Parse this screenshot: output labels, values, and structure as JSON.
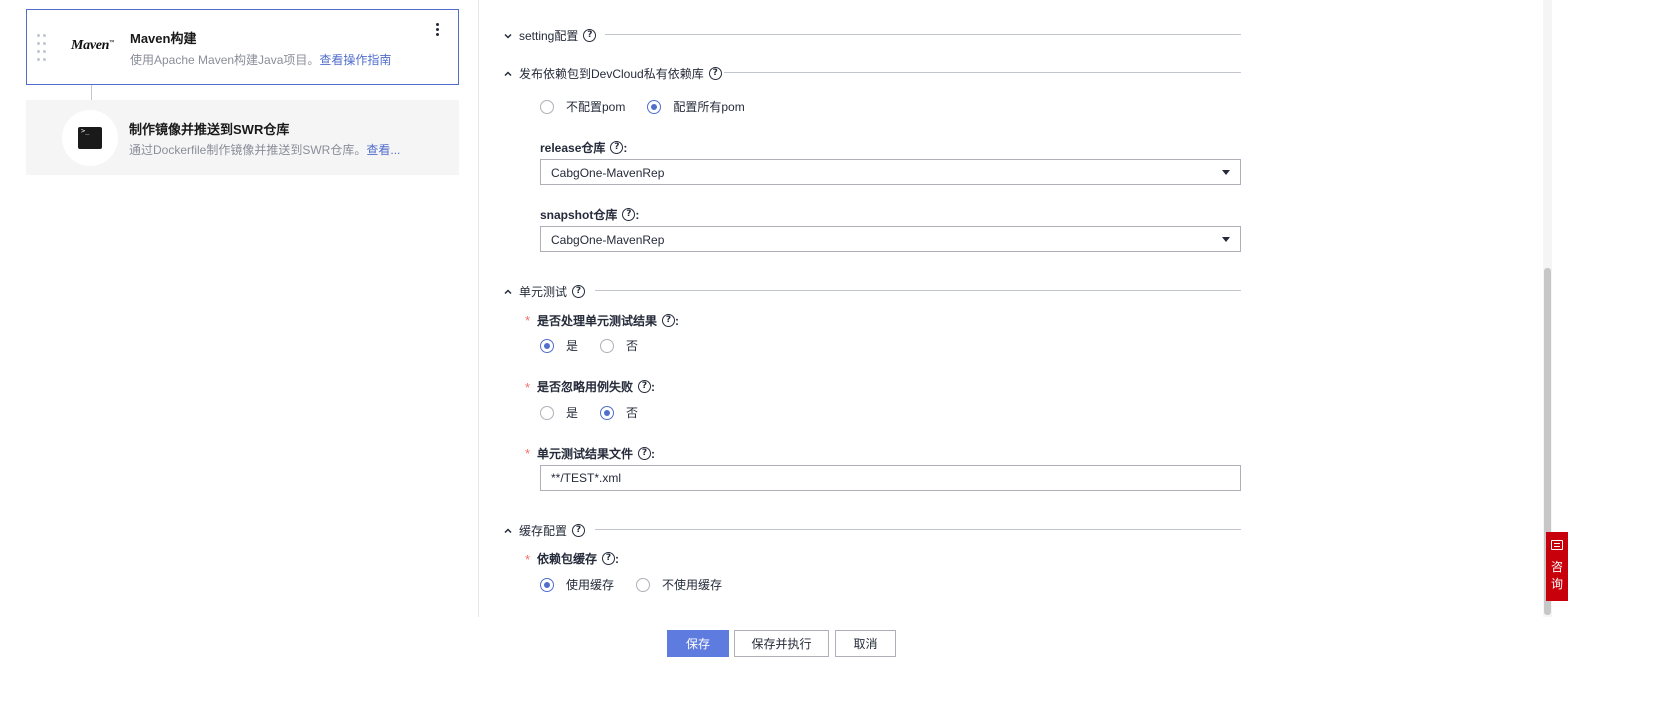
{
  "tasks": [
    {
      "title": "Maven构建",
      "description": "使用Apache Maven构建Java项目。",
      "link": "查看操作指南",
      "logo_text": "Maven",
      "icon": "maven-logo"
    },
    {
      "title": "制作镜像并推送到SWR仓库",
      "description": "通过Dockerfile制作镜像并推送到SWR仓库。",
      "link": "查看...",
      "icon": "terminal-icon"
    }
  ],
  "sections": {
    "setting": {
      "title": "setting配置"
    },
    "publish": {
      "title": "发布依赖包到DevCloud私有依赖库",
      "options": [
        "不配置pom",
        "配置所有pom"
      ],
      "selected": "配置所有pom",
      "release_label": "release仓库",
      "release_value": "CabgOne-MavenRep",
      "snapshot_label": "snapshot仓库",
      "snapshot_value": "CabgOne-MavenRep"
    },
    "unit_test": {
      "title": "单元测试",
      "handle_label": "是否处理单元测试结果",
      "handle_options": [
        "是",
        "否"
      ],
      "handle_selected": "是",
      "ignore_label": "是否忽略用例失败",
      "ignore_options": [
        "是",
        "否"
      ],
      "ignore_selected": "否",
      "file_label": "单元测试结果文件",
      "file_value": "**/TEST*.xml"
    },
    "cache": {
      "title": "缓存配置",
      "label": "依赖包缓存",
      "options": [
        "使用缓存",
        "不使用缓存"
      ],
      "selected": "使用缓存"
    }
  },
  "colon": ":",
  "required_mark": "*",
  "help_glyph": "?",
  "footer": {
    "save": "保存",
    "save_run": "保存并执行",
    "cancel": "取消"
  },
  "consult": {
    "label": "咨询"
  },
  "colors": {
    "accent": "#526ecc",
    "primary_button": "#5e7ce0",
    "required": "#f66f6a",
    "consult": "#c7000b"
  }
}
